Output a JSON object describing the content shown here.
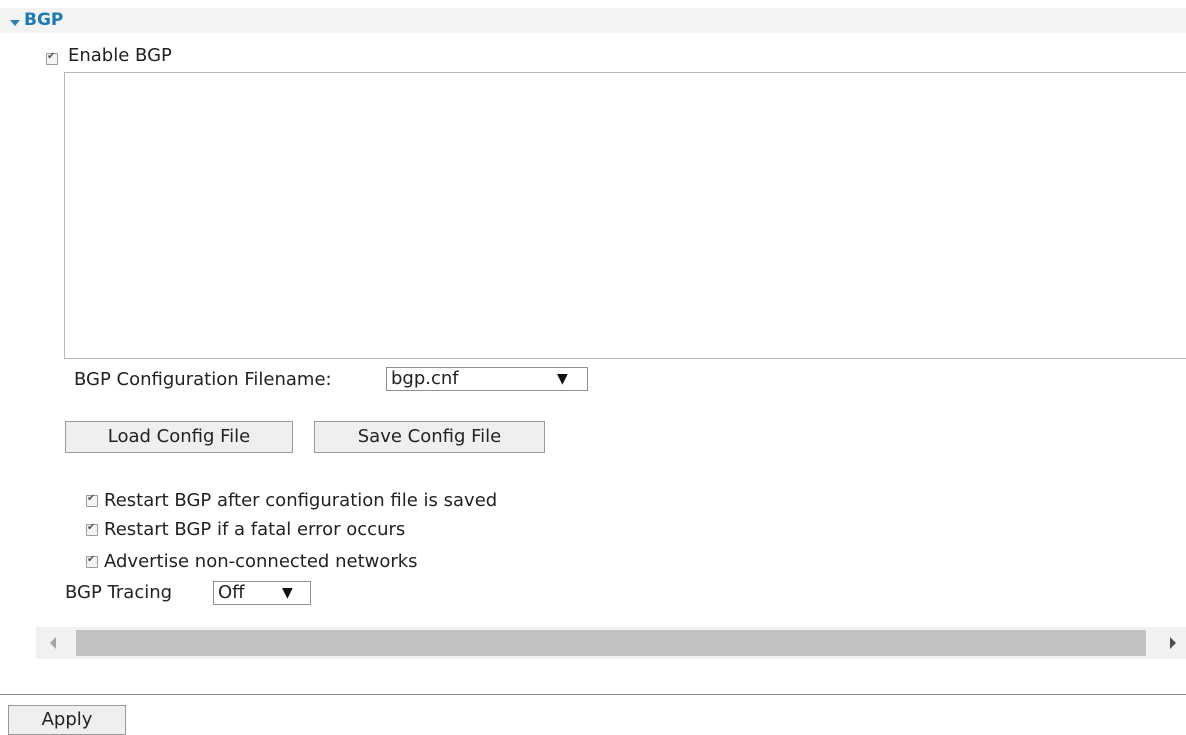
{
  "section": {
    "title": "BGP"
  },
  "enable": {
    "label": "Enable BGP",
    "checked": true
  },
  "config": {
    "filename_label": "BGP Configuration Filename:",
    "filename_value": "bgp.cnf",
    "textarea_value": ""
  },
  "buttons": {
    "load": "Load Config File",
    "save": "Save Config File",
    "apply": "Apply"
  },
  "options": [
    {
      "label": "Restart BGP after configuration file is saved",
      "checked": true
    },
    {
      "label": "Restart BGP if a fatal error occurs",
      "checked": true
    },
    {
      "label": "Advertise non-connected networks",
      "checked": true
    }
  ],
  "tracing": {
    "label": "BGP Tracing",
    "value": "Off"
  },
  "icons": {
    "collapse": "caret-down-icon",
    "dropdown": "triangle-down-icon",
    "scroll_left": "scroll-left-arrow-icon",
    "scroll_right": "scroll-right-arrow-icon"
  },
  "colors": {
    "section_title": "#1d7ab3",
    "section_bg": "#f3f3f3"
  }
}
